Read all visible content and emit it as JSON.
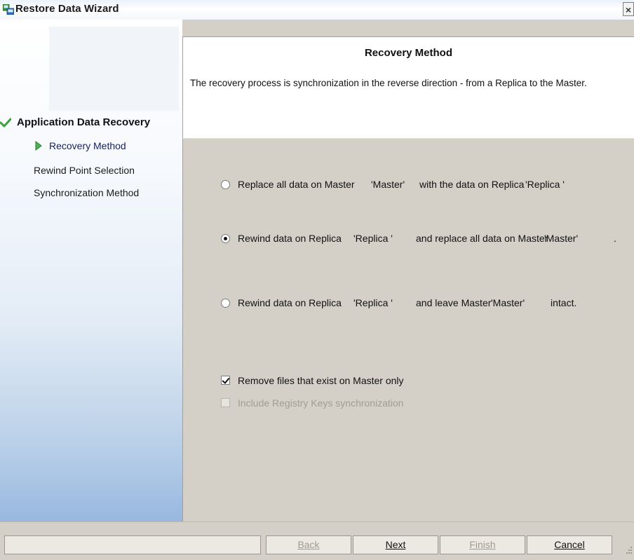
{
  "window": {
    "title": "Restore Data Wizard",
    "close_label": "×"
  },
  "steps": {
    "main": "Application Data Recovery",
    "items": [
      {
        "label": "Recovery Method",
        "state": "current"
      },
      {
        "label": "Rewind Point Selection",
        "state": "pending"
      },
      {
        "label": "Synchronization Method",
        "state": "pending"
      }
    ]
  },
  "header": {
    "title": "Recovery Method",
    "description": "The recovery process is synchronization in the reverse direction - from a Replica to the Master."
  },
  "options": {
    "replace_all": {
      "p1": "Replace all data on Master",
      "master": "'Master'",
      "p2": "with the data on Replica",
      "replica": "'Replica '",
      "selected": false
    },
    "rewind_replace": {
      "p1": "Rewind data on Replica",
      "replica": "'Replica '",
      "p2": "and replace all data on Master",
      "master": "'Master'",
      "p3": ".",
      "selected": true
    },
    "rewind_leave": {
      "p1": "Rewind data on Replica",
      "replica": "'Replica '",
      "p2": "and leave Master",
      "master": "'Master'",
      "p3": "intact.",
      "selected": false
    }
  },
  "checkboxes": {
    "remove_files": {
      "label": "Remove files that exist on Master only",
      "checked": true,
      "enabled": true
    },
    "registry_keys": {
      "label": "Include Registry Keys synchronization",
      "checked": false,
      "enabled": false
    }
  },
  "buttons": {
    "back": "Back",
    "next": "Next",
    "finish": "Finish",
    "cancel": "Cancel"
  },
  "colors": {
    "dialog_bg": "#d4d0c8",
    "step_check": "#3aa23a",
    "step_arrow": "#2f8f2f"
  }
}
